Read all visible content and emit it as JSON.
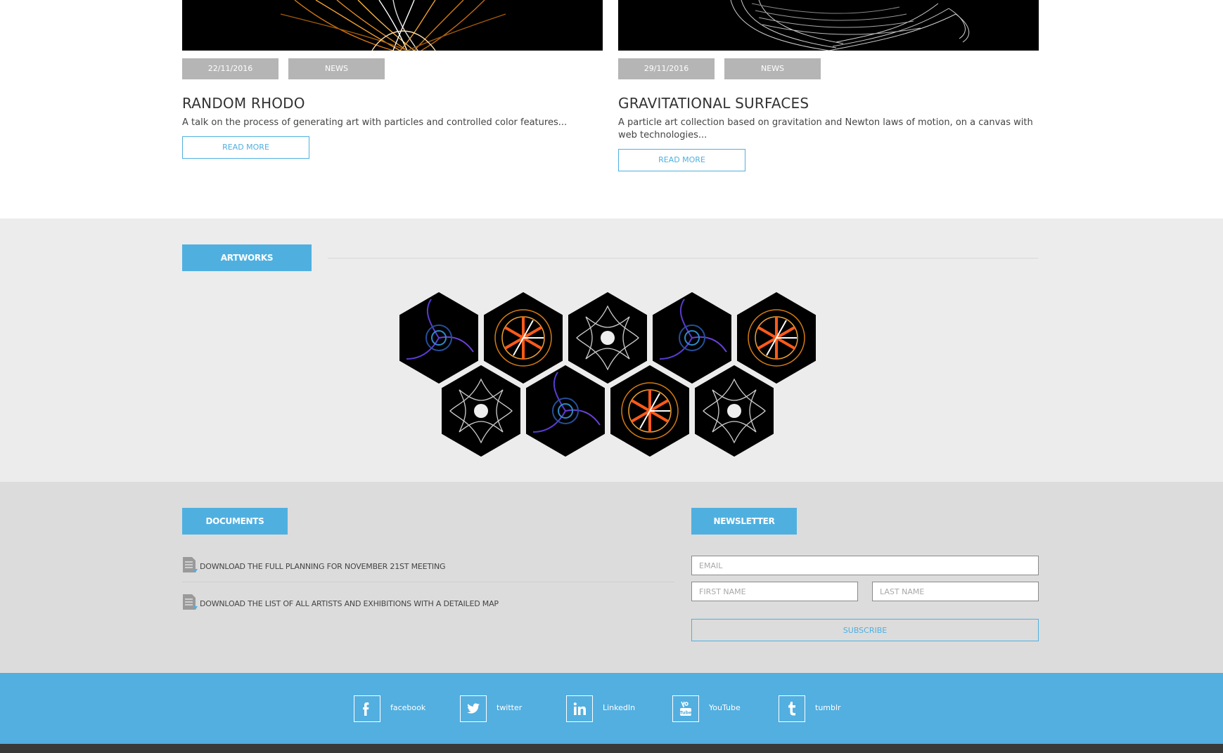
{
  "news": {
    "cards": [
      {
        "date": "22/11/2016",
        "category": "NEWS",
        "title": "RANDOM RHODO",
        "description": "A talk on the process of generating art with particles and controlled color features...",
        "button": "READ MORE"
      },
      {
        "date": "29/11/2016",
        "category": "NEWS",
        "title": "GRAVITATIONAL SURFACES",
        "description": "A particle art collection based on gravitation and Newton laws of motion, on a canvas with web technologies...",
        "button": "READ MORE"
      }
    ]
  },
  "artworks": {
    "label": "ARTWORKS",
    "items": [
      "purple-swirl",
      "orange-flower",
      "white-star",
      "purple-swirl",
      "orange-flower",
      "white-star",
      "purple-swirl",
      "orange-flower",
      "white-star"
    ]
  },
  "documents": {
    "label": "DOCUMENTS",
    "items": [
      "DOWNLOAD THE FULL PLANNING FOR NOVEMBER 21ST MEETING",
      "DOWNLOAD THE LIST OF ALL ARTISTS AND EXHIBITIONS WITH A DETAILED MAP"
    ]
  },
  "newsletter": {
    "label": "NEWSLETTER",
    "email_placeholder": "EMAIL",
    "first_name_placeholder": "FIRST NAME",
    "last_name_placeholder": "LAST NAME",
    "subscribe": "SUBSCRIBE"
  },
  "social": [
    {
      "icon": "facebook-icon",
      "label": "facebook"
    },
    {
      "icon": "twitter-icon",
      "label": "twitter"
    },
    {
      "icon": "linkedin-icon",
      "label": "LinkedIn"
    },
    {
      "icon": "youtube-icon",
      "label": "YouTube"
    },
    {
      "icon": "tumblr-icon",
      "label": "tumblr"
    }
  ],
  "colors": {
    "accent": "#4fb0e0",
    "pill": "#b5b5b5",
    "artworks_bg": "#ececec",
    "lower_bg": "#dcdcdc"
  }
}
